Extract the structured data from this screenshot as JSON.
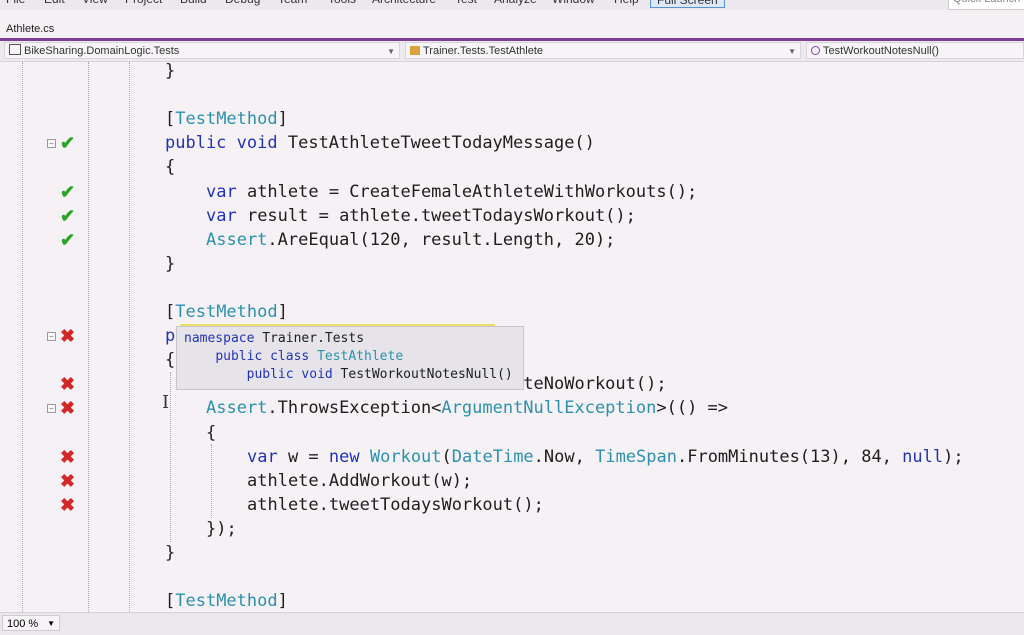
{
  "menu": [
    "File",
    "Edit",
    "View",
    "Project",
    "Build",
    "Debug",
    "Team",
    "Tools",
    "Architecture",
    "Test",
    "Analyze",
    "Window",
    "Help"
  ],
  "full_screen": "Full Screen",
  "quick_launch": "Quick Launch",
  "tab": "Athlete.cs",
  "nav": {
    "project": "BikeSharing.DomainLogic.Tests",
    "class": "Trainer.Tests.TestAthlete",
    "member": "TestWorkoutNotesNull()"
  },
  "code": [
    {
      "ind": 2,
      "t": [
        [
          "}",
          ""
        ]
      ]
    },
    {
      "ind": 0,
      "t": []
    },
    {
      "ind": 2,
      "t": [
        [
          "[",
          ""
        ],
        [
          "TestMethod",
          "ty"
        ],
        [
          "]",
          ""
        ]
      ]
    },
    {
      "ind": 2,
      "m": "ok",
      "c": 1,
      "t": [
        [
          "public",
          "kw"
        ],
        [
          " ",
          ""
        ],
        [
          "void",
          "kw"
        ],
        [
          " TestAthleteTweetTodayMessage()",
          ""
        ]
      ]
    },
    {
      "ind": 2,
      "t": [
        [
          "{",
          ""
        ]
      ]
    },
    {
      "ind": 3,
      "m": "ok",
      "t": [
        [
          "var",
          "kw"
        ],
        [
          " athlete = CreateFemaleAthleteWithWorkouts();",
          ""
        ]
      ]
    },
    {
      "ind": 3,
      "m": "ok",
      "t": [
        [
          "var",
          "kw"
        ],
        [
          " result = athlete.tweetTodaysWorkout();",
          ""
        ]
      ]
    },
    {
      "ind": 3,
      "m": "ok",
      "t": [
        [
          "Assert",
          "ty"
        ],
        [
          ".AreEqual(120, result.Length, 20);",
          ""
        ]
      ]
    },
    {
      "ind": 2,
      "t": [
        [
          "}",
          ""
        ]
      ]
    },
    {
      "ind": 0,
      "t": []
    },
    {
      "ind": 2,
      "t": [
        [
          "[",
          ""
        ],
        [
          "TestMethod",
          "ty"
        ],
        [
          "]",
          ""
        ]
      ]
    },
    {
      "ind": 2,
      "m": "bad",
      "c": 1,
      "t": [
        [
          "p",
          "kw"
        ]
      ]
    },
    {
      "ind": 2,
      "t": [
        [
          "{",
          ""
        ]
      ]
    },
    {
      "ind": 3,
      "m": "bad",
      "t": [
        [
          "var",
          "kw"
        ],
        [
          " athlete = CreateFemaleAthleteNoWorkout();",
          ""
        ]
      ]
    },
    {
      "ind": 3,
      "m": "bad",
      "c": 1,
      "t": [
        [
          "Assert",
          "ty"
        ],
        [
          ".ThrowsException<",
          ""
        ],
        [
          "ArgumentNullException",
          "ty"
        ],
        [
          ">(() =>",
          ""
        ]
      ]
    },
    {
      "ind": 3,
      "t": [
        [
          "{",
          ""
        ]
      ]
    },
    {
      "ind": 4,
      "m": "bad",
      "t": [
        [
          "var",
          "kw"
        ],
        [
          " w = ",
          ""
        ],
        [
          "new",
          "kw"
        ],
        [
          " ",
          ""
        ],
        [
          "Workout",
          "ty"
        ],
        [
          "(",
          ""
        ],
        [
          "DateTime",
          "ty"
        ],
        [
          ".Now, ",
          ""
        ],
        [
          "TimeSpan",
          "ty"
        ],
        [
          ".FromMinutes(13), 84, ",
          ""
        ],
        [
          "null",
          "kw"
        ],
        [
          ");",
          ""
        ]
      ]
    },
    {
      "ind": 4,
      "m": "bad",
      "t": [
        [
          "athlete.AddWorkout(w);",
          ""
        ]
      ]
    },
    {
      "ind": 4,
      "m": "bad",
      "t": [
        [
          "athlete.tweetTodaysWorkout();",
          ""
        ]
      ]
    },
    {
      "ind": 3,
      "t": [
        [
          "});",
          ""
        ]
      ]
    },
    {
      "ind": 2,
      "t": [
        [
          "}",
          ""
        ]
      ]
    },
    {
      "ind": 0,
      "t": []
    },
    {
      "ind": 2,
      "t": [
        [
          "[",
          ""
        ],
        [
          "TestMethod",
          "ty"
        ],
        [
          "]",
          ""
        ]
      ]
    }
  ],
  "tooltip": {
    "l1kw": "namespace",
    "l1": " Trainer.Tests",
    "l2kw": "public class",
    "l2": "TestAthlete",
    "l3kw": "public void",
    "l3": " TestWorkoutNotesNull()"
  },
  "zoom": "100 %"
}
